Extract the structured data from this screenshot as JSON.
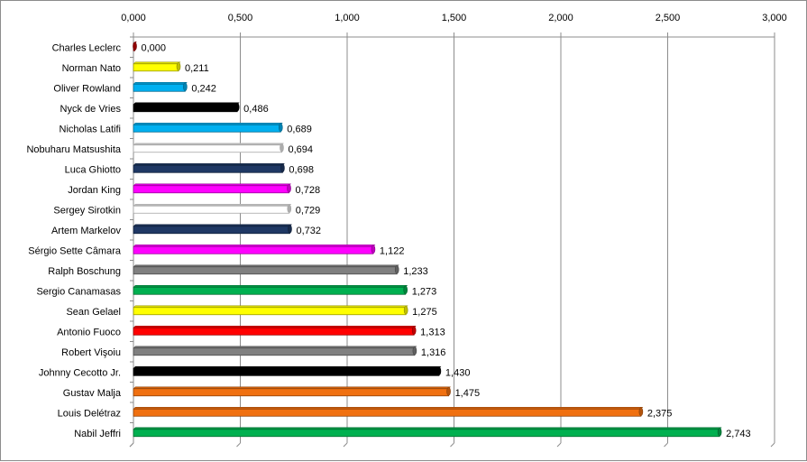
{
  "chart_data": {
    "type": "bar",
    "orientation": "horizontal",
    "categories": [
      "Charles Leclerc",
      "Norman Nato",
      "Oliver Rowland",
      "Nyck de Vries",
      "Nicholas Latifi",
      "Nobuharu Matsushita",
      "Luca Ghiotto",
      "Jordan King",
      "Sergey Sirotkin",
      "Artem Markelov",
      "Sérgio Sette Câmara",
      "Ralph Boschung",
      "Sergio Canamasas",
      "Sean Gelael",
      "Antonio Fuoco",
      "Robert Vişoiu",
      "Johnny Cecotto Jr.",
      "Gustav Malja",
      "Louis Delétraz",
      "Nabil Jeffri"
    ],
    "values": [
      0.0,
      0.211,
      0.242,
      0.486,
      0.689,
      0.694,
      0.698,
      0.728,
      0.729,
      0.732,
      1.122,
      1.233,
      1.273,
      1.275,
      1.313,
      1.316,
      1.43,
      1.475,
      2.375,
      2.743
    ],
    "value_labels": [
      "0,000",
      "0,211",
      "0,242",
      "0,486",
      "0,689",
      "0,694",
      "0,698",
      "0,728",
      "0,729",
      "0,732",
      "1,122",
      "1,233",
      "1,273",
      "1,275",
      "1,313",
      "1,316",
      "1,430",
      "1,475",
      "2,375",
      "2,743"
    ],
    "bar_colors": [
      "#c00000",
      "#ffff00",
      "#00b0f0",
      "#000000",
      "#00b0f0",
      "#ffffff",
      "#1f3864",
      "#ff00ff",
      "#ffffff",
      "#1f3864",
      "#ff00ff",
      "#808080",
      "#00b050",
      "#ffff00",
      "#ff0000",
      "#808080",
      "#000000",
      "#f07010",
      "#f07010",
      "#00b050"
    ],
    "x_ticks": [
      "0,000",
      "0,500",
      "1,000",
      "1,500",
      "2,000",
      "2,500",
      "3,000"
    ],
    "x_tick_values": [
      0,
      0.5,
      1.0,
      1.5,
      2.0,
      2.5,
      3.0
    ],
    "xlim": [
      0,
      3.0
    ],
    "x_axis_position": "top",
    "grid": true,
    "legend": false,
    "title": "",
    "xlabel": "",
    "ylabel": ""
  }
}
